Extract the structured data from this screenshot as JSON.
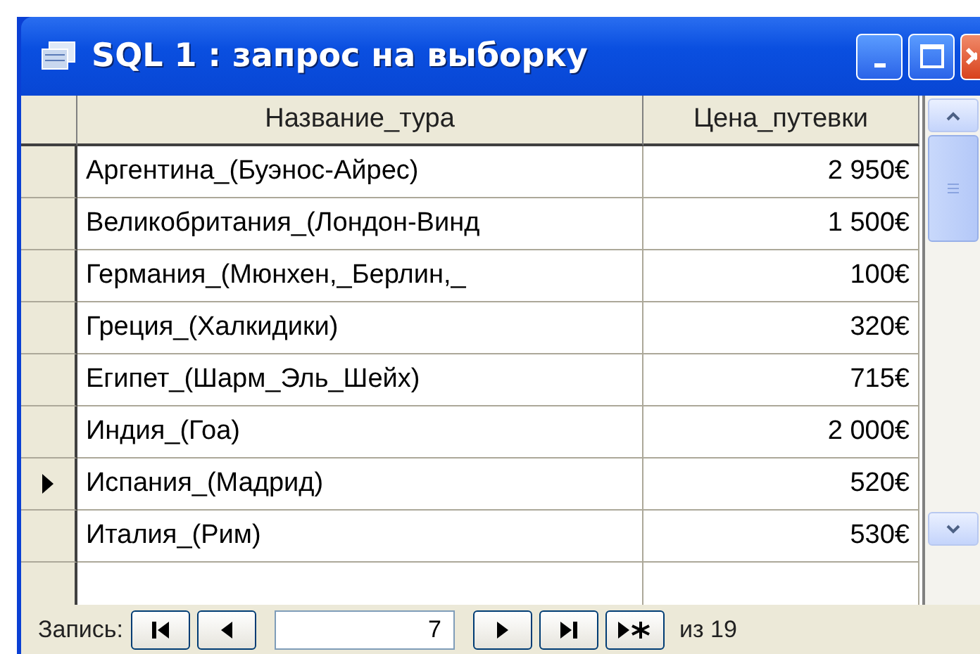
{
  "window": {
    "title": "SQL 1 : запрос на выборку"
  },
  "table": {
    "columns": [
      "Название_тура",
      "Цена_путевки"
    ],
    "rows": [
      {
        "cells": [
          "Аргентина_(Буэнос-Айрес)",
          "2 950€"
        ],
        "selected": false
      },
      {
        "cells": [
          "Великобритания_(Лондон-Винд",
          "1 500€"
        ],
        "selected": false
      },
      {
        "cells": [
          "Германия_(Мюнхен,_Берлин,_",
          "100€"
        ],
        "selected": false
      },
      {
        "cells": [
          "Греция_(Халкидики)",
          "320€"
        ],
        "selected": false
      },
      {
        "cells": [
          "Египет_(Шарм_Эль_Шейх)",
          "715€"
        ],
        "selected": false
      },
      {
        "cells": [
          "Индия_(Гоа)",
          "2 000€"
        ],
        "selected": false
      },
      {
        "cells": [
          "Испания_(Мадрид)",
          "520€"
        ],
        "selected": true
      },
      {
        "cells": [
          "Италия_(Рим)",
          "530€"
        ],
        "selected": false
      }
    ]
  },
  "navigation": {
    "label": "Запись:",
    "current": "7",
    "total": "из 19"
  }
}
